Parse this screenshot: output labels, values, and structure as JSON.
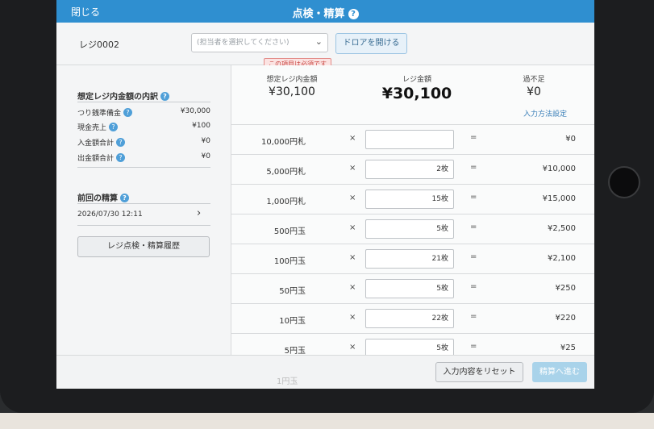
{
  "header": {
    "close_label": "閉じる",
    "title": "点検・精算",
    "help_icon": "help-circle-icon"
  },
  "controls": {
    "register_name": "レジ0002",
    "staff_placeholder": "(担当者を選択してください)",
    "drawer_button": "ドロアを開ける",
    "required_badge": "この項目は必須です"
  },
  "breakdown": {
    "title": "想定レジ内金額の内訳",
    "items": [
      {
        "label": "つり銭準備金",
        "value": "¥30,000"
      },
      {
        "label": "現金売上",
        "value": "¥100"
      },
      {
        "label": "入金額合計",
        "value": "¥0"
      },
      {
        "label": "出金額合計",
        "value": "¥0"
      }
    ]
  },
  "previous": {
    "title": "前回の精算",
    "date": "2026/07/30 12:11"
  },
  "history_button": "レジ点検・精算履歴",
  "summary": {
    "expected_label": "想定レジ内金額",
    "expected_value": "¥30,100",
    "register_label": "レジ金額",
    "register_value": "¥30,100",
    "diff_label": "過不足",
    "diff_value": "¥0",
    "input_method_link": "入力方法設定"
  },
  "denominations": [
    {
      "name": "10,000円札",
      "qty": "",
      "amount": "¥0"
    },
    {
      "name": "5,000円札",
      "qty": "2枚",
      "amount": "¥10,000"
    },
    {
      "name": "1,000円札",
      "qty": "15枚",
      "amount": "¥15,000"
    },
    {
      "name": "500円玉",
      "qty": "5枚",
      "amount": "¥2,500"
    },
    {
      "name": "100円玉",
      "qty": "21枚",
      "amount": "¥2,100"
    },
    {
      "name": "50円玉",
      "qty": "5枚",
      "amount": "¥250"
    },
    {
      "name": "10円玉",
      "qty": "22枚",
      "amount": "¥220"
    },
    {
      "name": "5円玉",
      "qty": "5枚",
      "amount": "¥25"
    }
  ],
  "symbols": {
    "times": "×",
    "equals": "="
  },
  "peek_row": "1円玉",
  "footer": {
    "reset_button": "入力内容をリセット",
    "next_button": "精算へ進む"
  },
  "colors": {
    "topbar": "#2f8fd0",
    "help_icon": "#4f9fd8",
    "required_text": "#c84440",
    "next_button": "#a9d3ea"
  }
}
